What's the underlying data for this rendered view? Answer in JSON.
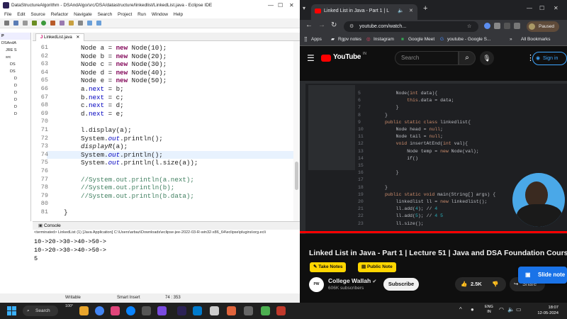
{
  "eclipse": {
    "title": "DataStructureAlgorithm - DSAndAlgo/src/DSA/datastructure/linkedlist/LinkedList.java - Eclipse IDE",
    "menu": [
      "File",
      "Edit",
      "Source",
      "Refactor",
      "Navigate",
      "Search",
      "Project",
      "Run",
      "Window",
      "Help"
    ],
    "pkg_tab": "P",
    "pkg_items": [
      "DSAndA",
      "JRE S",
      "src",
      "DS",
      "DS",
      "D",
      "D",
      "D",
      "D",
      "D",
      "D"
    ],
    "editor_tab": "LinkedList.java",
    "code_lines": [
      {
        "n": "61",
        "parts": [
          [
            "",
            "Node a = "
          ],
          [
            "kw",
            "new"
          ],
          [
            "",
            " Node(10);"
          ]
        ]
      },
      {
        "n": "62",
        "parts": [
          [
            "",
            "Node b = "
          ],
          [
            "kw",
            "new"
          ],
          [
            "",
            " Node(20);"
          ]
        ]
      },
      {
        "n": "63",
        "parts": [
          [
            "",
            "Node c = "
          ],
          [
            "kw",
            "new"
          ],
          [
            "",
            " Node(30);"
          ]
        ]
      },
      {
        "n": "64",
        "parts": [
          [
            "",
            "Node d = "
          ],
          [
            "kw",
            "new"
          ],
          [
            "",
            " Node(40);"
          ]
        ]
      },
      {
        "n": "65",
        "parts": [
          [
            "",
            "Node e = "
          ],
          [
            "kw",
            "new"
          ],
          [
            "",
            " Node(50);"
          ]
        ]
      },
      {
        "n": "66",
        "parts": [
          [
            "",
            "a."
          ],
          [
            "fld",
            "next"
          ],
          [
            "",
            " = b;"
          ]
        ]
      },
      {
        "n": "67",
        "parts": [
          [
            "",
            "b."
          ],
          [
            "fld",
            "next"
          ],
          [
            "",
            " = c;"
          ]
        ]
      },
      {
        "n": "68",
        "parts": [
          [
            "",
            "c."
          ],
          [
            "fld",
            "next"
          ],
          [
            "",
            " = d;"
          ]
        ]
      },
      {
        "n": "69",
        "parts": [
          [
            "",
            "d."
          ],
          [
            "fld",
            "next"
          ],
          [
            "",
            " = e;"
          ]
        ]
      },
      {
        "n": "70",
        "parts": [
          [
            "",
            ""
          ]
        ]
      },
      {
        "n": "71",
        "parts": [
          [
            "",
            "l.display(a);"
          ]
        ]
      },
      {
        "n": "72",
        "parts": [
          [
            "",
            "System."
          ],
          [
            "fld ital",
            "out"
          ],
          [
            "",
            ".println();"
          ]
        ]
      },
      {
        "n": "73",
        "parts": [
          [
            "ital",
            "displayR"
          ],
          [
            "",
            "(a);"
          ]
        ]
      },
      {
        "n": "74",
        "parts": [
          [
            "",
            "System."
          ],
          [
            "fld ital",
            "out"
          ],
          [
            "",
            ".println();"
          ]
        ]
      },
      {
        "n": "75",
        "parts": [
          [
            "",
            "System."
          ],
          [
            "fld ital",
            "out"
          ],
          [
            "",
            ".println(l.size(a));"
          ]
        ]
      },
      {
        "n": "76",
        "parts": [
          [
            "",
            ""
          ]
        ]
      },
      {
        "n": "77",
        "parts": [
          [
            "cmt",
            "//System.out.println(a.next);"
          ]
        ]
      },
      {
        "n": "78",
        "parts": [
          [
            "cmt",
            "//System.out.println(b);"
          ]
        ]
      },
      {
        "n": "79",
        "parts": [
          [
            "cmt",
            "//System.out.println(b.data);"
          ]
        ]
      },
      {
        "n": "80",
        "parts": [
          [
            "",
            ""
          ]
        ]
      },
      {
        "n": "81",
        "parts": [
          [
            "",
            "}"
          ]
        ]
      }
    ],
    "console_tab": "Console",
    "console_header": "<terminated> LinkedList (1) [Java Application] C:\\Users\\arbaz\\Downloads\\eclipse-jee-2022-03-R-win32-x86_64\\eclipse\\plugins\\org.ecli",
    "console_lines": [
      "10->20->30->40->50->",
      "10->20->30->40->50->",
      "5"
    ],
    "status": {
      "mode": "Writable",
      "insert": "Smart Insert",
      "pos": "74 : 353"
    }
  },
  "browser": {
    "tab_title": "Linked List in Java - Part 1 | L",
    "url": "youtube.com/watch...",
    "paused": "Paused",
    "bookmarks": [
      "Apps",
      "Rgpv notes",
      "Instagram",
      "Google Meet",
      "youtube - Google S..."
    ],
    "all_bookmarks": "All Bookmarks",
    "yt_logo": "YouTube",
    "yt_region": "IN",
    "search_placeholder": "Search",
    "sign_in": "Sign in",
    "video_title": "Linked List in Java - Part 1 | Lecture 51 | Java and DSA Foundation Course",
    "take_notes": "Take Notes",
    "public_note": "Public Note",
    "channel": "College Wallah",
    "subscribers": "606K subscribers",
    "subscribe": "Subscribe",
    "likes": "2.5K",
    "share": "Share",
    "slide_note": "Slide note",
    "ide": {
      "lines": [
        {
          "n": "5",
          "t": "    Node(int data){"
        },
        {
          "n": "6",
          "t": "        this.data = data;"
        },
        {
          "n": "7",
          "t": "    }"
        },
        {
          "n": "8",
          "t": "}"
        },
        {
          "n": "9",
          "t": "public static class linkedlist{"
        },
        {
          "n": "10",
          "t": "    Node head = null;"
        },
        {
          "n": "11",
          "t": "    Node tail = null;"
        },
        {
          "n": "12",
          "t": "    void insertAtEnd(int val){"
        },
        {
          "n": "13",
          "t": "        Node temp = new Node(val);"
        },
        {
          "n": "14",
          "t": "        if()"
        },
        {
          "n": "15",
          "t": ""
        },
        {
          "n": "16",
          "t": "    }"
        },
        {
          "n": "17",
          "t": ""
        },
        {
          "n": "18",
          "t": "}"
        },
        {
          "n": "19",
          "t": "public static void main(String[] args) {"
        },
        {
          "n": "20",
          "t": "    linkedlist ll = new linkedlist();"
        },
        {
          "n": "21",
          "t": "    ll.add(4); // 4"
        },
        {
          "n": "22",
          "t": "    ll.add(5); // 4 5"
        },
        {
          "n": "23",
          "t": "    ll.size();"
        }
      ]
    }
  },
  "taskbar": {
    "search": "Search",
    "weather": "100°",
    "lang": "ENG",
    "region": "IN",
    "time": "18:07",
    "date": "12-05-2024"
  },
  "colors": {
    "eclipse_bg": "#ffffff",
    "keyword": "#7f0055",
    "field": "#0000c0",
    "comment": "#3f7f5f",
    "yt_bg": "#0f0f0f",
    "chip": "#ffd600",
    "taskbar": "#202020"
  }
}
